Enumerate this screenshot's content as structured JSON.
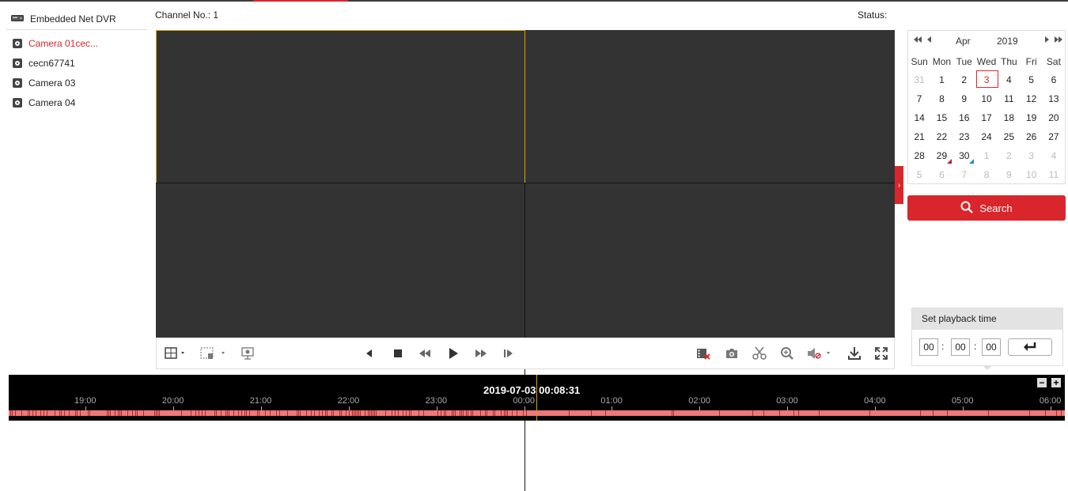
{
  "sidebar": {
    "root_label": "Embedded Net DVR",
    "cameras": [
      {
        "label": "Camera 01cec...",
        "active": true
      },
      {
        "label": "cecn67741",
        "active": false
      },
      {
        "label": "Camera 03",
        "active": false
      },
      {
        "label": "Camera 04",
        "active": false
      }
    ]
  },
  "header": {
    "channel_no": "Channel No.: 1",
    "status": "Status:"
  },
  "calendar": {
    "month": "Apr",
    "year": "2019",
    "weekdays": [
      "Sun",
      "Mon",
      "Tue",
      "Wed",
      "Thu",
      "Fri",
      "Sat"
    ],
    "weeks": [
      [
        "31",
        "1",
        "2",
        "3",
        "4",
        "5",
        "6"
      ],
      [
        "7",
        "8",
        "9",
        "10",
        "11",
        "12",
        "13"
      ],
      [
        "14",
        "15",
        "16",
        "17",
        "18",
        "19",
        "20"
      ],
      [
        "21",
        "22",
        "23",
        "24",
        "25",
        "26",
        "27"
      ],
      [
        "28",
        "29",
        "30",
        "1",
        "2",
        "3",
        "4"
      ],
      [
        "5",
        "6",
        "7",
        "8",
        "9",
        "10",
        "11"
      ]
    ],
    "selected_day": "3"
  },
  "search": {
    "label": "Search"
  },
  "playback_time": {
    "title": "Set playback time",
    "hour": "00",
    "minute": "00",
    "second": "00"
  },
  "timeline": {
    "current": "2019-07-03 00:08:31",
    "ticks": [
      "19:00",
      "20:00",
      "21:00",
      "22:00",
      "23:00",
      "00:00",
      "01:00",
      "02:00",
      "03:00",
      "04:00",
      "05:00",
      "06:00"
    ],
    "zoom_out": "−",
    "zoom_in": "+"
  },
  "colors": {
    "accent": "#d9262c",
    "selected_pane": "#e0a000",
    "record_bar": "#ef7878"
  },
  "icons": {
    "toolbar_left": [
      "window-layout-icon",
      "clear-all-icon",
      "digital-zoom-icon"
    ],
    "toolbar_center": [
      "reverse-play-icon",
      "stop-icon",
      "slow-forward-icon",
      "play-icon",
      "fast-forward-icon",
      "single-frame-icon"
    ],
    "toolbar_right": [
      "stop-all-clip-icon",
      "capture-icon",
      "clip-icon",
      "zoom-in-icon",
      "volume-icon",
      "download-icon",
      "fullscreen-icon"
    ]
  }
}
